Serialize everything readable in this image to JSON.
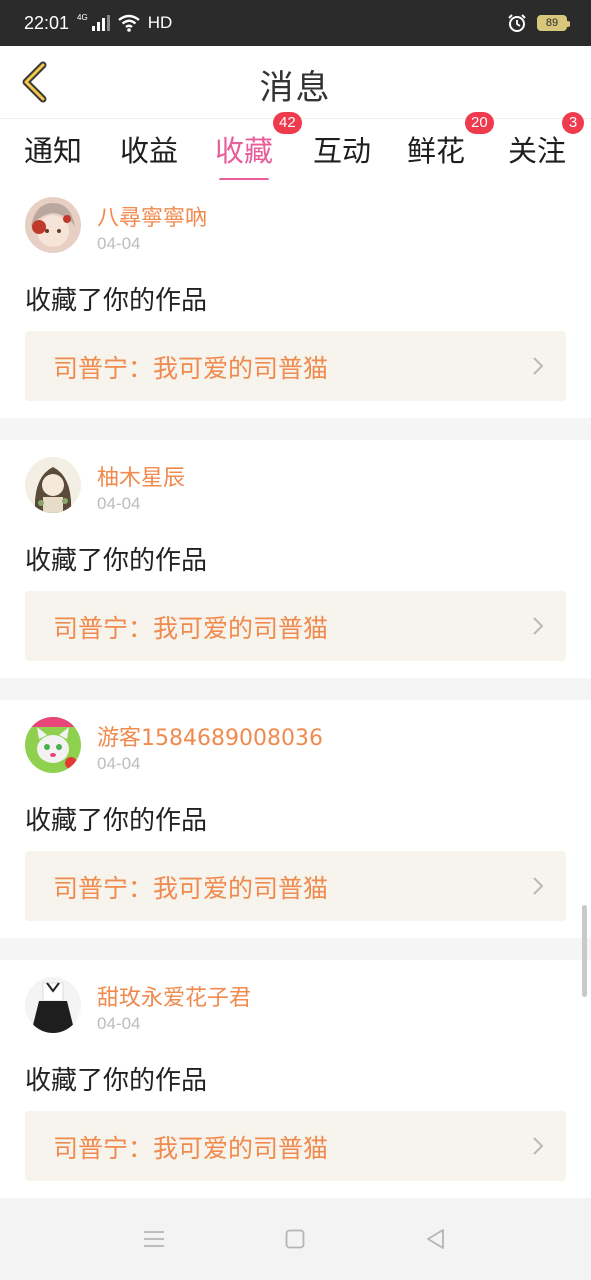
{
  "status_bar": {
    "time": "22:01",
    "network": "4G",
    "hd": "HD",
    "battery": "89"
  },
  "header": {
    "title": "消息"
  },
  "tabs": [
    {
      "label": "通知",
      "badge": null
    },
    {
      "label": "收益",
      "badge": null
    },
    {
      "label": "收藏",
      "badge": "42",
      "active": true
    },
    {
      "label": "互动",
      "badge": null
    },
    {
      "label": "鲜花",
      "badge": "20"
    },
    {
      "label": "关注",
      "badge": "3"
    }
  ],
  "feed": [
    {
      "username": "八尋寧寧吶",
      "date": "04-04",
      "action": "收藏了你的作品",
      "work": "司普宁：我可爱的司普猫"
    },
    {
      "username": "柚木星辰",
      "date": "04-04",
      "action": "收藏了你的作品",
      "work": "司普宁：我可爱的司普猫"
    },
    {
      "username": "游客1584689008036",
      "date": "04-04",
      "action": "收藏了你的作品",
      "work": "司普宁：我可爱的司普猫"
    },
    {
      "username": "甜玫永爱花子君",
      "date": "04-04",
      "action": "收藏了你的作品",
      "work": "司普宁：我可爱的司普猫"
    }
  ],
  "colors": {
    "accent": "#e85d9a",
    "username": "#f08a4e",
    "badge": "#f03a4d",
    "work_bg": "#f6f4ec"
  },
  "icons": [
    "back-arrow-icon",
    "signal-icon",
    "wifi-icon",
    "alarm-icon",
    "battery-icon",
    "chevron-right-icon",
    "menu-icon",
    "home-icon",
    "back-triangle-icon"
  ]
}
